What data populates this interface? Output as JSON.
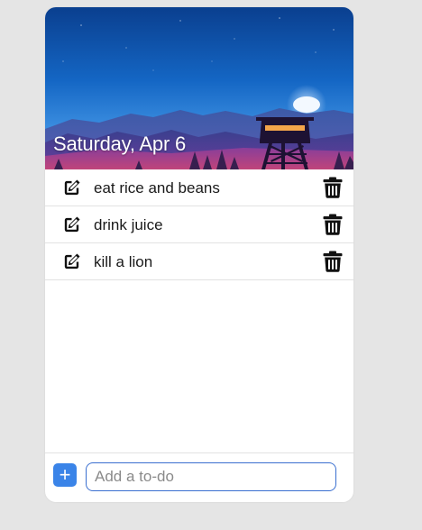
{
  "header": {
    "date_label": "Saturday, Apr 6"
  },
  "todos": [
    {
      "text": "eat rice and beans",
      "edit_icon": "edit-icon",
      "delete_icon": "trash-icon"
    },
    {
      "text": "drink juice",
      "edit_icon": "edit-icon",
      "delete_icon": "trash-icon"
    },
    {
      "text": "kill a lion",
      "edit_icon": "edit-icon",
      "delete_icon": "trash-icon"
    }
  ],
  "footer": {
    "add_button_label": "+",
    "input_value": "",
    "input_placeholder": "Add a to-do"
  },
  "colors": {
    "accent": "#3a84e8",
    "input_border": "#3a6fd0",
    "background": "#e5e5e5",
    "card": "#ffffff"
  }
}
